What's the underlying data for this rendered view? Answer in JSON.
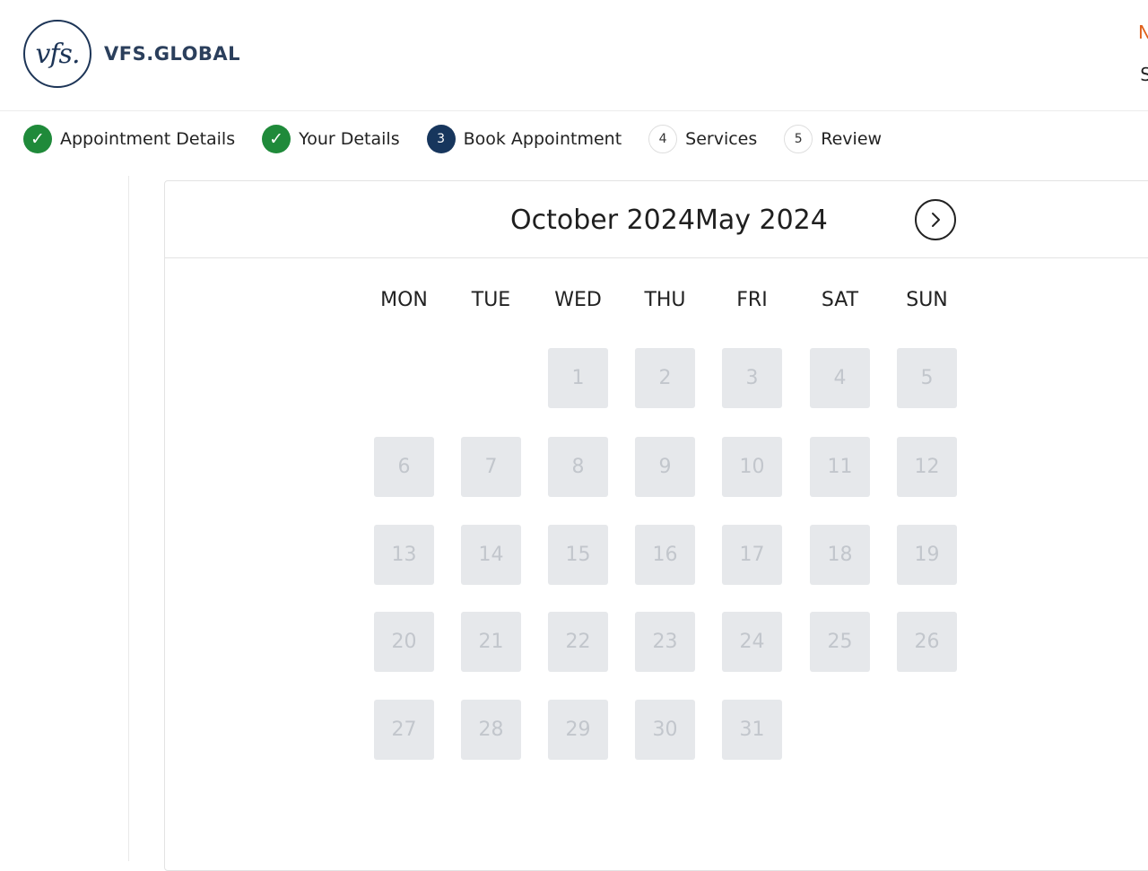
{
  "header": {
    "logo_mark": "vfs.",
    "logo_text": "VFS.GLOBAL",
    "right_top": "N",
    "right_bottom": "S"
  },
  "stepper": [
    {
      "number": "✓",
      "label": "Appointment Details",
      "state": "done"
    },
    {
      "number": "✓",
      "label": "Your Details",
      "state": "done"
    },
    {
      "number": "3",
      "label": "Book Appointment",
      "state": "active"
    },
    {
      "number": "4",
      "label": "Services",
      "state": "pending"
    },
    {
      "number": "5",
      "label": "Review",
      "state": "pending"
    }
  ],
  "calendar": {
    "title": "October 2024May 2024",
    "next_icon": "chevron-right-icon",
    "weekdays": [
      "MON",
      "TUE",
      "WED",
      "THU",
      "FRI",
      "SAT",
      "SUN"
    ],
    "first_weekday_index": 2,
    "days": [
      "1",
      "2",
      "3",
      "4",
      "5",
      "6",
      "7",
      "8",
      "9",
      "10",
      "11",
      "12",
      "13",
      "14",
      "15",
      "16",
      "17",
      "18",
      "19",
      "20",
      "21",
      "22",
      "23",
      "24",
      "25",
      "26",
      "27",
      "28",
      "29",
      "30",
      "31"
    ]
  },
  "colors": {
    "brand_navy": "#17365d",
    "done_green": "#1f8a3a",
    "accent_orange": "#e0601b",
    "day_disabled_bg": "#e6e8eb",
    "day_disabled_text": "#c2c6cc"
  }
}
